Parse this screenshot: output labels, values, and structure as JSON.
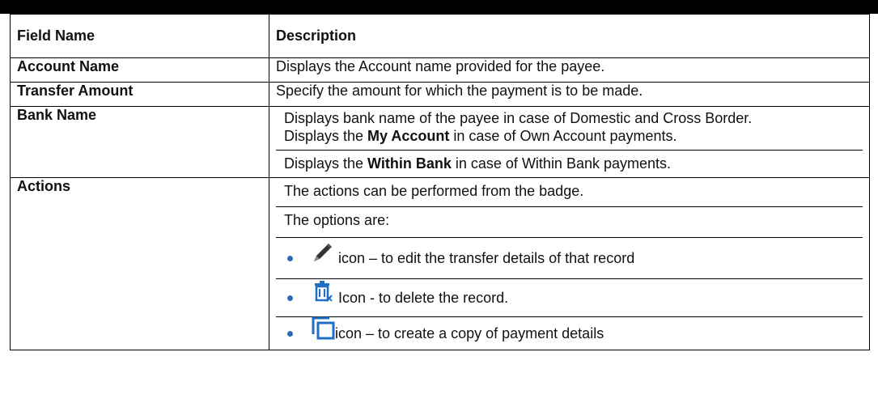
{
  "table": {
    "headers": {
      "field": "Field Name",
      "description": "Description"
    },
    "rows": [
      {
        "field": "Account Name",
        "description": "Displays the Account name provided for the payee."
      },
      {
        "field": "Transfer Amount",
        "description": "Specify the amount for which the payment is to be made."
      },
      {
        "field": "Bank Name",
        "line1": "Displays bank name of the payee in case of Domestic and Cross Border.",
        "line2_pre": "Displays the ",
        "line2_bold": "My Account",
        "line2_post": " in case of Own Account payments.",
        "line3_pre": "Displays the ",
        "line3_bold": "Within Bank",
        "line3_post": " in case of Within Bank payments."
      },
      {
        "field": "Actions",
        "line1": "The actions can be performed from the badge.",
        "line2": "The options are:",
        "bullets": [
          {
            "icon": "pencil-icon",
            "text": "icon – to edit the transfer details of that record"
          },
          {
            "icon": "delete-icon",
            "text": "Icon - to delete the record."
          },
          {
            "icon": "copy-icon",
            "text": "icon – to create a copy of payment details"
          }
        ]
      }
    ]
  },
  "colors": {
    "bullet": "#2d6db5",
    "icon_blue": "#1f6fc5"
  }
}
